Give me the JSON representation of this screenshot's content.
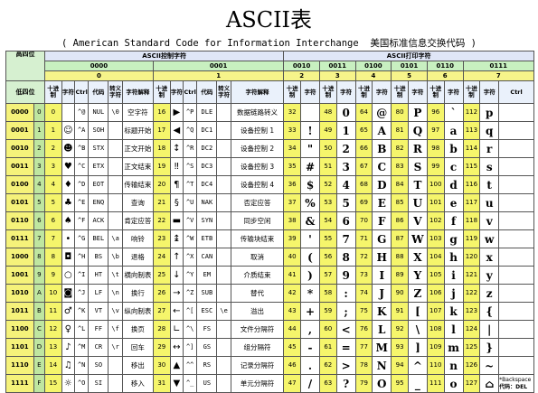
{
  "title": "ASCII表",
  "subtitle": "( American Standard Code for Information Interchange  美国标准信息交换代码 )",
  "header": {
    "high_label": "高四位",
    "low_label": "低四位",
    "control_group": "ASCII控制字符",
    "print_group": "ASCII打印字符",
    "high_bits": [
      "0000",
      "0001",
      "0010",
      "0011",
      "0100",
      "0101",
      "0110",
      "0111"
    ],
    "high_dec": [
      "0",
      "1",
      "2",
      "3",
      "4",
      "5",
      "6",
      "7"
    ],
    "col_dec": "十进制",
    "col_char": "字符",
    "col_ctrl": "Ctrl",
    "col_code": "代码",
    "col_escape": "转义字符",
    "col_desc": "字符解释"
  },
  "rows": [
    {
      "low": "0000",
      "n": "0",
      "c0": [
        "0",
        "",
        "^@",
        "NUL",
        "\\0",
        "空字符"
      ],
      "c1": [
        "16",
        "▶",
        "^P",
        "DLE",
        "",
        "数据链路转义"
      ],
      "p": [
        [
          "32",
          ""
        ],
        [
          "48",
          "0"
        ],
        [
          "64",
          "@"
        ],
        [
          "80",
          "P"
        ],
        [
          "96",
          "`"
        ],
        [
          "112",
          "p"
        ]
      ]
    },
    {
      "low": "0001",
      "n": "1",
      "c0": [
        "1",
        "☺",
        "^A",
        "SOH",
        "",
        "标题开始"
      ],
      "c1": [
        "17",
        "◀",
        "^Q",
        "DC1",
        "",
        "设备控制 1"
      ],
      "p": [
        [
          "33",
          "!"
        ],
        [
          "49",
          "1"
        ],
        [
          "65",
          "A"
        ],
        [
          "81",
          "Q"
        ],
        [
          "97",
          "a"
        ],
        [
          "113",
          "q"
        ]
      ]
    },
    {
      "low": "0010",
      "n": "2",
      "c0": [
        "2",
        "☻",
        "^B",
        "STX",
        "",
        "正文开始"
      ],
      "c1": [
        "18",
        "↕",
        "^R",
        "DC2",
        "",
        "设备控制 2"
      ],
      "p": [
        [
          "34",
          "\""
        ],
        [
          "50",
          "2"
        ],
        [
          "66",
          "B"
        ],
        [
          "82",
          "R"
        ],
        [
          "98",
          "b"
        ],
        [
          "114",
          "r"
        ]
      ]
    },
    {
      "low": "0011",
      "n": "3",
      "c0": [
        "3",
        "♥",
        "^C",
        "ETX",
        "",
        "正文结束"
      ],
      "c1": [
        "19",
        "‼",
        "^S",
        "DC3",
        "",
        "设备控制 3"
      ],
      "p": [
        [
          "35",
          "#"
        ],
        [
          "51",
          "3"
        ],
        [
          "67",
          "C"
        ],
        [
          "83",
          "S"
        ],
        [
          "99",
          "c"
        ],
        [
          "115",
          "s"
        ]
      ]
    },
    {
      "low": "0100",
      "n": "4",
      "c0": [
        "4",
        "♦",
        "^D",
        "EOT",
        "",
        "传输结束"
      ],
      "c1": [
        "20",
        "¶",
        "^T",
        "DC4",
        "",
        "设备控制 4"
      ],
      "p": [
        [
          "36",
          "$"
        ],
        [
          "52",
          "4"
        ],
        [
          "68",
          "D"
        ],
        [
          "84",
          "T"
        ],
        [
          "100",
          "d"
        ],
        [
          "116",
          "t"
        ]
      ]
    },
    {
      "low": "0101",
      "n": "5",
      "c0": [
        "5",
        "♣",
        "^E",
        "ENQ",
        "",
        "查询"
      ],
      "c1": [
        "21",
        "§",
        "^U",
        "NAK",
        "",
        "否定应答"
      ],
      "p": [
        [
          "37",
          "%"
        ],
        [
          "53",
          "5"
        ],
        [
          "69",
          "E"
        ],
        [
          "85",
          "U"
        ],
        [
          "101",
          "e"
        ],
        [
          "117",
          "u"
        ]
      ]
    },
    {
      "low": "0110",
      "n": "6",
      "c0": [
        "6",
        "♠",
        "^F",
        "ACK",
        "",
        "肯定应答"
      ],
      "c1": [
        "22",
        "▬",
        "^V",
        "SYN",
        "",
        "同步空闲"
      ],
      "p": [
        [
          "38",
          "&"
        ],
        [
          "54",
          "6"
        ],
        [
          "70",
          "F"
        ],
        [
          "86",
          "V"
        ],
        [
          "102",
          "f"
        ],
        [
          "118",
          "v"
        ]
      ]
    },
    {
      "low": "0111",
      "n": "7",
      "c0": [
        "7",
        "•",
        "^G",
        "BEL",
        "\\a",
        "响铃"
      ],
      "c1": [
        "23",
        "↨",
        "^W",
        "ETB",
        "",
        "传输块结束"
      ],
      "p": [
        [
          "39",
          "'"
        ],
        [
          "55",
          "7"
        ],
        [
          "71",
          "G"
        ],
        [
          "87",
          "W"
        ],
        [
          "103",
          "g"
        ],
        [
          "119",
          "w"
        ]
      ]
    },
    {
      "low": "1000",
      "n": "8",
      "c0": [
        "8",
        "◘",
        "^H",
        "BS",
        "\\b",
        "退格"
      ],
      "c1": [
        "24",
        "↑",
        "^X",
        "CAN",
        "",
        "取消"
      ],
      "p": [
        [
          "40",
          "("
        ],
        [
          "56",
          "8"
        ],
        [
          "72",
          "H"
        ],
        [
          "88",
          "X"
        ],
        [
          "104",
          "h"
        ],
        [
          "120",
          "x"
        ]
      ]
    },
    {
      "low": "1001",
      "n": "9",
      "c0": [
        "9",
        "○",
        "^I",
        "HT",
        "\\t",
        "横向制表"
      ],
      "c1": [
        "25",
        "↓",
        "^Y",
        "EM",
        "",
        "介质结束"
      ],
      "p": [
        [
          "41",
          ")"
        ],
        [
          "57",
          "9"
        ],
        [
          "73",
          "I"
        ],
        [
          "89",
          "Y"
        ],
        [
          "105",
          "i"
        ],
        [
          "121",
          "y"
        ]
      ]
    },
    {
      "low": "1010",
      "n": "A",
      "c0": [
        "10",
        "◙",
        "^J",
        "LF",
        "\\n",
        "换行"
      ],
      "c1": [
        "26",
        "→",
        "^Z",
        "SUB",
        "",
        "替代"
      ],
      "p": [
        [
          "42",
          "*"
        ],
        [
          "58",
          ":"
        ],
        [
          "74",
          "J"
        ],
        [
          "90",
          "Z"
        ],
        [
          "106",
          "j"
        ],
        [
          "122",
          "z"
        ]
      ]
    },
    {
      "low": "1011",
      "n": "B",
      "c0": [
        "11",
        "♂",
        "^K",
        "VT",
        "\\v",
        "纵向制表"
      ],
      "c1": [
        "27",
        "←",
        "^[",
        "ESC",
        "\\e",
        "溢出"
      ],
      "p": [
        [
          "43",
          "+"
        ],
        [
          "59",
          ";"
        ],
        [
          "75",
          "K"
        ],
        [
          "91",
          "["
        ],
        [
          "107",
          "k"
        ],
        [
          "123",
          "{"
        ]
      ]
    },
    {
      "low": "1100",
      "n": "C",
      "c0": [
        "12",
        "♀",
        "^L",
        "FF",
        "\\f",
        "换页"
      ],
      "c1": [
        "28",
        "∟",
        "^\\",
        "FS",
        "",
        "文件分隔符"
      ],
      "p": [
        [
          "44",
          ","
        ],
        [
          "60",
          "<"
        ],
        [
          "76",
          "L"
        ],
        [
          "92",
          "\\"
        ],
        [
          "108",
          "l"
        ],
        [
          "124",
          "|"
        ]
      ]
    },
    {
      "low": "1101",
      "n": "D",
      "c0": [
        "13",
        "♪",
        "^M",
        "CR",
        "\\r",
        "回车"
      ],
      "c1": [
        "29",
        "↔",
        "^]",
        "GS",
        "",
        "组分隔符"
      ],
      "p": [
        [
          "45",
          "-"
        ],
        [
          "61",
          "="
        ],
        [
          "77",
          "M"
        ],
        [
          "93",
          "]"
        ],
        [
          "109",
          "m"
        ],
        [
          "125",
          "}"
        ]
      ]
    },
    {
      "low": "1110",
      "n": "E",
      "c0": [
        "14",
        "♫",
        "^N",
        "SO",
        "",
        "移出"
      ],
      "c1": [
        "30",
        "▲",
        "^^",
        "RS",
        "",
        "记录分隔符"
      ],
      "p": [
        [
          "46",
          "."
        ],
        [
          "62",
          ">"
        ],
        [
          "78",
          "N"
        ],
        [
          "94",
          "^"
        ],
        [
          "110",
          "n"
        ],
        [
          "126",
          "~"
        ]
      ]
    },
    {
      "low": "1111",
      "n": "F",
      "c0": [
        "15",
        "☼",
        "^O",
        "SI",
        "",
        "移入"
      ],
      "c1": [
        "31",
        "▼",
        "^_",
        "US",
        "",
        "单元分隔符"
      ],
      "p": [
        [
          "47",
          "/"
        ],
        [
          "63",
          "?"
        ],
        [
          "79",
          "O"
        ],
        [
          "95",
          "_"
        ],
        [
          "111",
          "o"
        ],
        [
          "127",
          "⌂"
        ]
      ]
    }
  ],
  "del_note": {
    "line1": "*Backspace",
    "line2": "代码：DEL"
  },
  "colors": {
    "yellow": "#f5f56b",
    "green": "#c8f0c0",
    "blue": "#dfe6f7"
  }
}
